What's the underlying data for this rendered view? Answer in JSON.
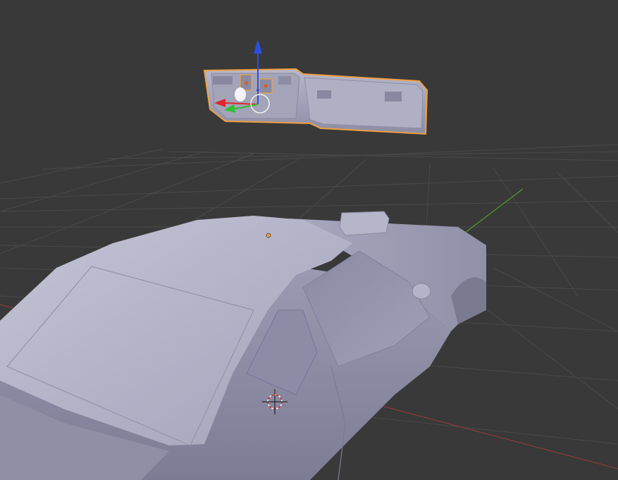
{
  "viewport": {
    "background_color": "#393939",
    "grid_line_color": "#4a4a4a",
    "x_axis_color": "#8a3b3b",
    "y_axis_color": "#4f9a2a"
  },
  "objects": {
    "selected_object": "dashboard-panel",
    "selection_outline_color": "#f0a040",
    "mesh_color": "#a8a8c0",
    "other_object": "car-body"
  },
  "gizmo": {
    "x_arrow_color": "#e0262b",
    "y_arrow_color": "#2ec02e",
    "z_arrow_color": "#2a4fe6"
  },
  "icons": {
    "cursor": "3d-cursor-icon",
    "origin": "object-origin-dot"
  }
}
